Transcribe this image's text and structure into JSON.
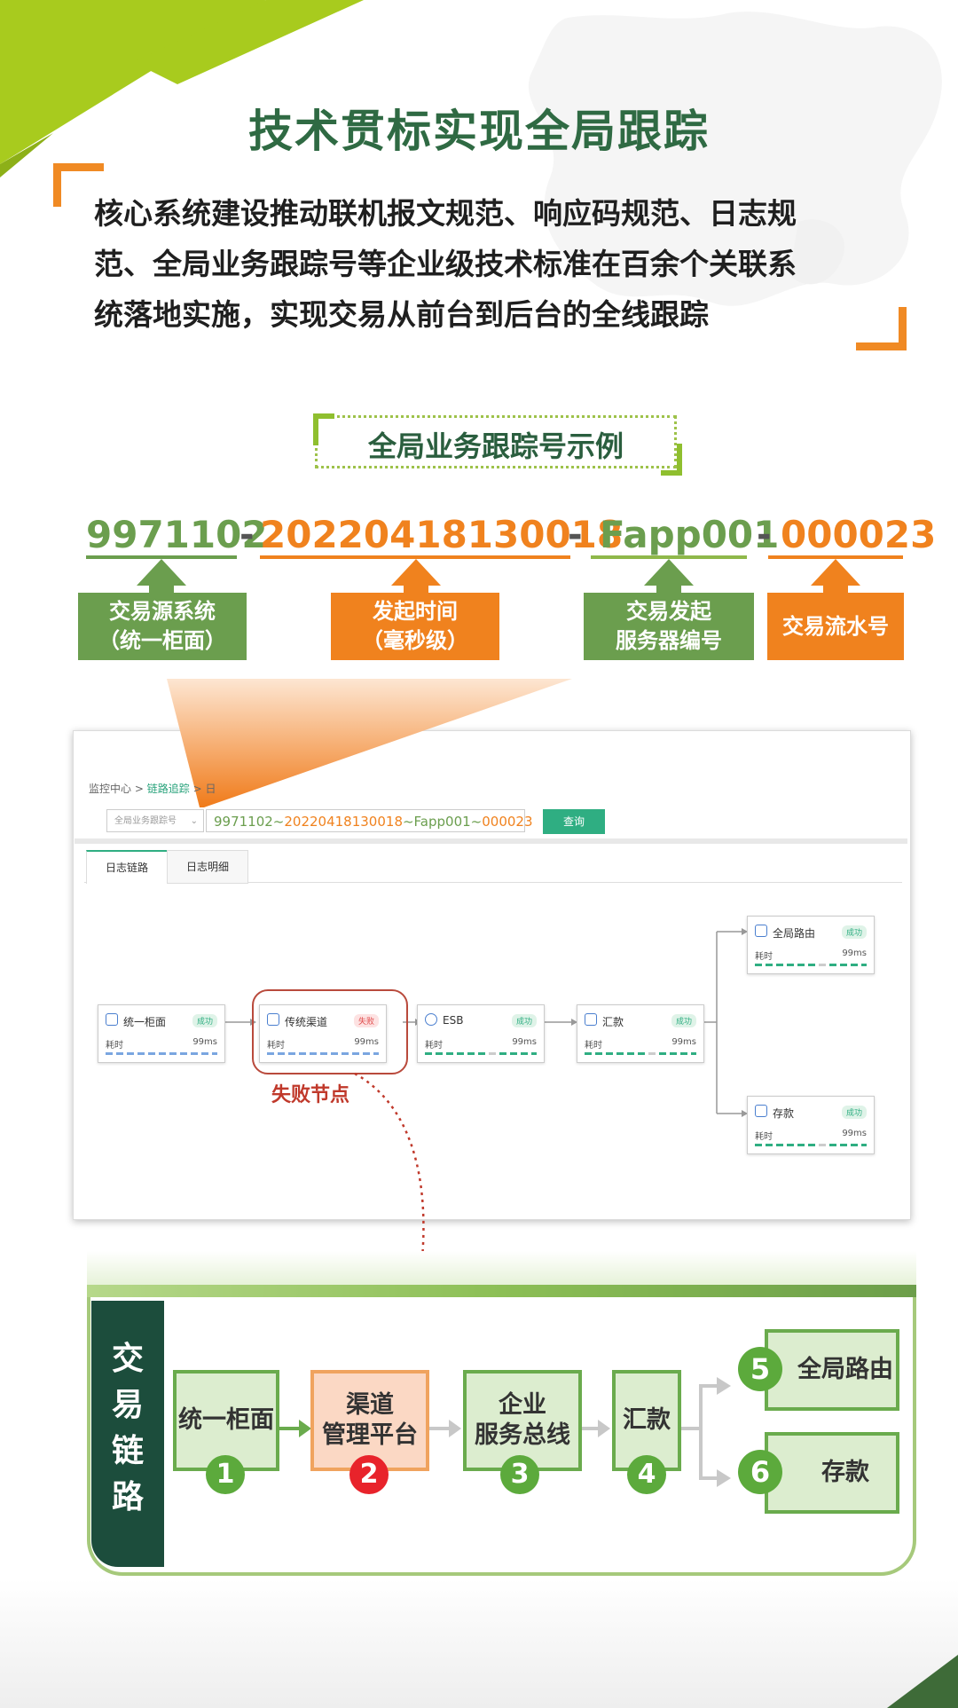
{
  "title": "技术贯标实现全局跟踪",
  "intro_lines": [
    "核心系统建设推动联机报文规范、响应码规范、日志规",
    "范、全局业务跟踪号等企业级技术标准在百余个关联系",
    "统落地实施，实现交易从前台到后台的全线跟踪"
  ],
  "subtitle": "全局业务跟踪号示例",
  "trace_parts": [
    {
      "text": "9971102",
      "color": "#6b9e4e",
      "label": [
        "交易源系统",
        "（统一柜面）"
      ]
    },
    {
      "text": "20220418130018",
      "color": "#f0821e",
      "label": [
        "发起时间",
        "（毫秒级）"
      ]
    },
    {
      "text": "Fapp001",
      "color": "#6b9e4e",
      "label": [
        "交易发起",
        "服务器编号"
      ]
    },
    {
      "text": "000023",
      "color": "#f0821e",
      "label": [
        "交易流水号"
      ]
    }
  ],
  "separator": "-",
  "panel": {
    "breadcrumb": [
      "监控中心",
      "链路追踪",
      "日"
    ],
    "breadcrumb_sep": ">",
    "select_placeholder": "全局业务跟踪号",
    "trace_input_parts": [
      "9971102~",
      "20220418130018",
      "~Fapp001~",
      "000023"
    ],
    "query_button": "查询",
    "tabs": [
      "日志链路",
      "日志明细"
    ],
    "nodes": [
      {
        "name": "统一柜面",
        "status": "成功",
        "time_label": "耗时",
        "time": "99ms"
      },
      {
        "name": "传统渠道",
        "status": "失败",
        "time_label": "耗时",
        "time": "99ms"
      },
      {
        "name": "ESB",
        "status": "成功",
        "time_label": "耗时",
        "time": "99ms"
      },
      {
        "name": "汇款",
        "status": "成功",
        "time_label": "耗时",
        "time": "99ms"
      },
      {
        "name": "全局路由",
        "status": "成功",
        "time_label": "耗时",
        "time": "99ms"
      },
      {
        "name": "存款",
        "status": "成功",
        "time_label": "耗时",
        "time": "99ms"
      }
    ],
    "fail_label": "失败节点"
  },
  "chain": {
    "label_chars": [
      "交",
      "易",
      "链",
      "路"
    ],
    "steps": [
      {
        "num": "1",
        "lines": [
          "统一柜面"
        ]
      },
      {
        "num": "2",
        "lines": [
          "渠道",
          "管理平台"
        ]
      },
      {
        "num": "3",
        "lines": [
          "企业",
          "服务总线"
        ]
      },
      {
        "num": "4",
        "lines": [
          "汇款"
        ]
      },
      {
        "num": "5",
        "lines": [
          "全局路由"
        ]
      },
      {
        "num": "6",
        "lines": [
          "存款"
        ]
      }
    ]
  },
  "colors": {
    "green": "#6b9e4e",
    "orange": "#f0821e",
    "dark_green": "#1c4d3c",
    "fail_red": "#c0392b"
  }
}
